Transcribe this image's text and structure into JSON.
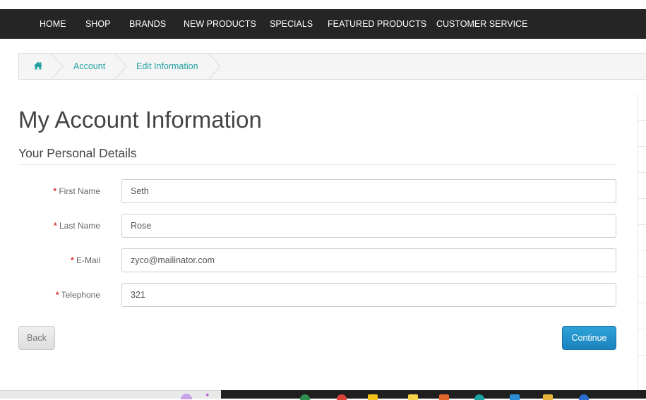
{
  "nav": {
    "items": [
      "HOME",
      "SHOP",
      "BRANDS",
      "NEW PRODUCTS",
      "SPECIALS",
      "FEATURED PRODUCTS",
      "CUSTOMER SERVICE"
    ]
  },
  "breadcrumb": {
    "home_icon": "home-icon",
    "items": [
      "Account",
      "Edit Information"
    ]
  },
  "page": {
    "title": "My Account Information",
    "legend": "Your Personal Details"
  },
  "form": {
    "required_mark": "*",
    "fields": [
      {
        "label": "First Name",
        "value": "Seth"
      },
      {
        "label": "Last Name",
        "value": "Rose"
      },
      {
        "label": "E-Mail",
        "value": "zyco@mailinator.com"
      },
      {
        "label": "Telephone",
        "value": "321"
      }
    ]
  },
  "buttons": {
    "back": "Back",
    "continue": "Continue"
  },
  "colors": {
    "navbar": "#252525",
    "link_teal": "#23a1a1",
    "required_red": "#d9302f",
    "primary_blue": "#1b83be"
  },
  "taskbar": {
    "icons": [
      "chrome-icon",
      "app-icon",
      "folder-icon",
      "app-icon",
      "app-icon",
      "edge-icon",
      "app-icon",
      "app-icon",
      "app-icon"
    ]
  }
}
